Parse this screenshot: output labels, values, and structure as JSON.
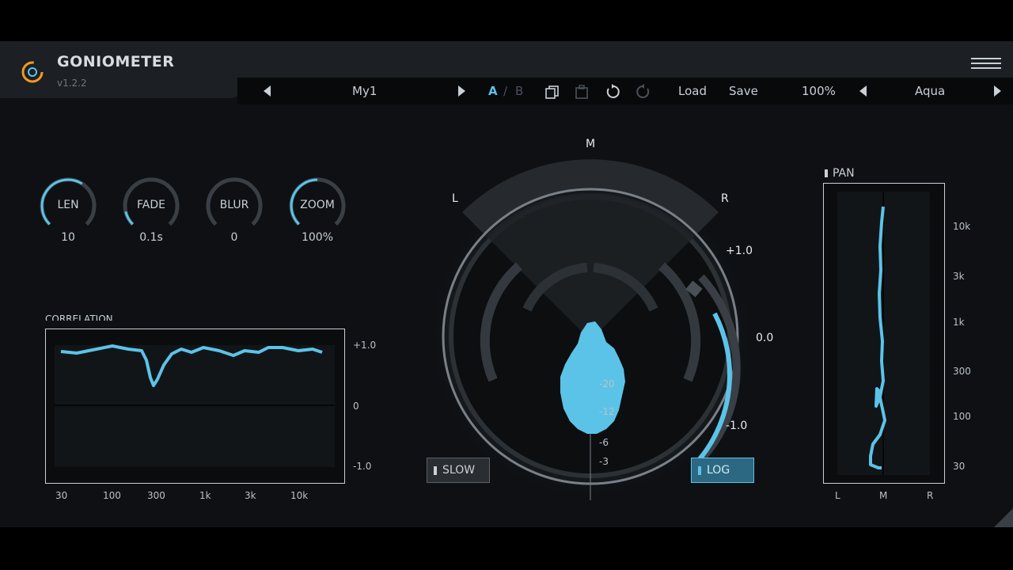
{
  "app": {
    "title": "GONIOMETER",
    "version": "v1.2.2"
  },
  "toolbar": {
    "preset_name": "My1",
    "ab_a": "A",
    "ab_sep": "/",
    "ab_b": "B",
    "load_label": "Load",
    "save_label": "Save",
    "zoom_level": "100%",
    "theme_name": "Aqua"
  },
  "knobs": [
    {
      "label": "LEN",
      "value": "10",
      "level": 0.62
    },
    {
      "label": "FADE",
      "value": "0.1s",
      "level": 0.12
    },
    {
      "label": "BLUR",
      "value": "0",
      "level": 0.0
    },
    {
      "label": "ZOOM",
      "value": "100%",
      "level": 0.5
    }
  ],
  "correlation": {
    "title": "CORRELATION",
    "y_ticks": [
      "+1.0",
      "0",
      "-1.0"
    ],
    "x_ticks": [
      "30",
      "100",
      "300",
      "1k",
      "3k",
      "10k"
    ]
  },
  "goniometer": {
    "labels": {
      "m": "M",
      "l": "L",
      "r": "R"
    },
    "scale": [
      "-20",
      "-12",
      "-6",
      "-3"
    ],
    "meter": {
      "top": "+1.0",
      "mid": "0.0",
      "bottom": "-1.0"
    },
    "slow_label": "SLOW",
    "log_label": "LOG"
  },
  "pan": {
    "title": "PAN",
    "y_ticks": [
      "10k",
      "3k",
      "1k",
      "300",
      "100",
      "30"
    ],
    "x_ticks": [
      "L",
      "M",
      "R"
    ]
  },
  "colors": {
    "accent": "#5cc3e8",
    "logo_orange": "#f39a1e",
    "background": "#0e1013"
  }
}
